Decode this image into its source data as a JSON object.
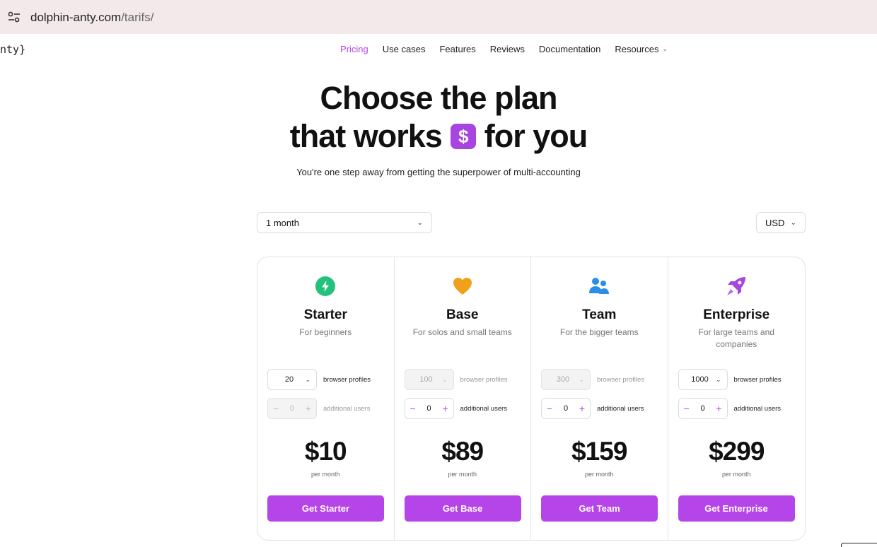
{
  "browser": {
    "url_domain": "dolphin-anty.com",
    "url_path": "/tarifs/",
    "left_fragment": "nty}"
  },
  "nav": {
    "items": [
      {
        "label": "Pricing",
        "active": true
      },
      {
        "label": "Use cases"
      },
      {
        "label": "Features"
      },
      {
        "label": "Reviews"
      },
      {
        "label": "Documentation"
      },
      {
        "label": "Resources",
        "has_dropdown": true
      }
    ]
  },
  "hero": {
    "title_line1": "Choose the plan",
    "title_line2_a": "that works",
    "title_line2_b": "for you",
    "dollar_symbol": "$",
    "subtitle": "You're one step away from getting the superpower of multi-accounting"
  },
  "filters": {
    "period": "1 month",
    "currency": "USD"
  },
  "plans": [
    {
      "name": "Starter",
      "desc": "For beginners",
      "icon": "lightning-icon",
      "icon_color": "#22c17c",
      "profiles": "20",
      "profiles_enabled": true,
      "profiles_label": "browser profiles",
      "users": "0",
      "users_enabled": false,
      "users_label": "additional users",
      "price": "$10",
      "per": "per month",
      "button": "Get Starter"
    },
    {
      "name": "Base",
      "desc": "For solos and small teams",
      "icon": "heart-icon",
      "icon_color": "#f0a01b",
      "profiles": "100",
      "profiles_enabled": false,
      "profiles_label": "browser profiles",
      "users": "0",
      "users_enabled": true,
      "users_label": "additional users",
      "price": "$89",
      "per": "per month",
      "button": "Get Base"
    },
    {
      "name": "Team",
      "desc": "For the bigger teams",
      "icon": "users-icon",
      "icon_color": "#2a8de8",
      "profiles": "300",
      "profiles_enabled": false,
      "profiles_label": "browser profiles",
      "users": "0",
      "users_enabled": true,
      "users_label": "additional users",
      "price": "$159",
      "per": "per month",
      "button": "Get Team"
    },
    {
      "name": "Enterprise",
      "desc": "For large teams and companies",
      "icon": "rocket-icon",
      "icon_color": "#a845e0",
      "profiles": "1000",
      "profiles_enabled": true,
      "profiles_label": "browser profiles",
      "users": "0",
      "users_enabled": true,
      "users_label": "additional users",
      "price": "$299",
      "per": "per month",
      "button": "Get Enterprise"
    }
  ],
  "colors": {
    "accent": "#b545e8",
    "url_bar_bg": "#f3e9ea"
  }
}
